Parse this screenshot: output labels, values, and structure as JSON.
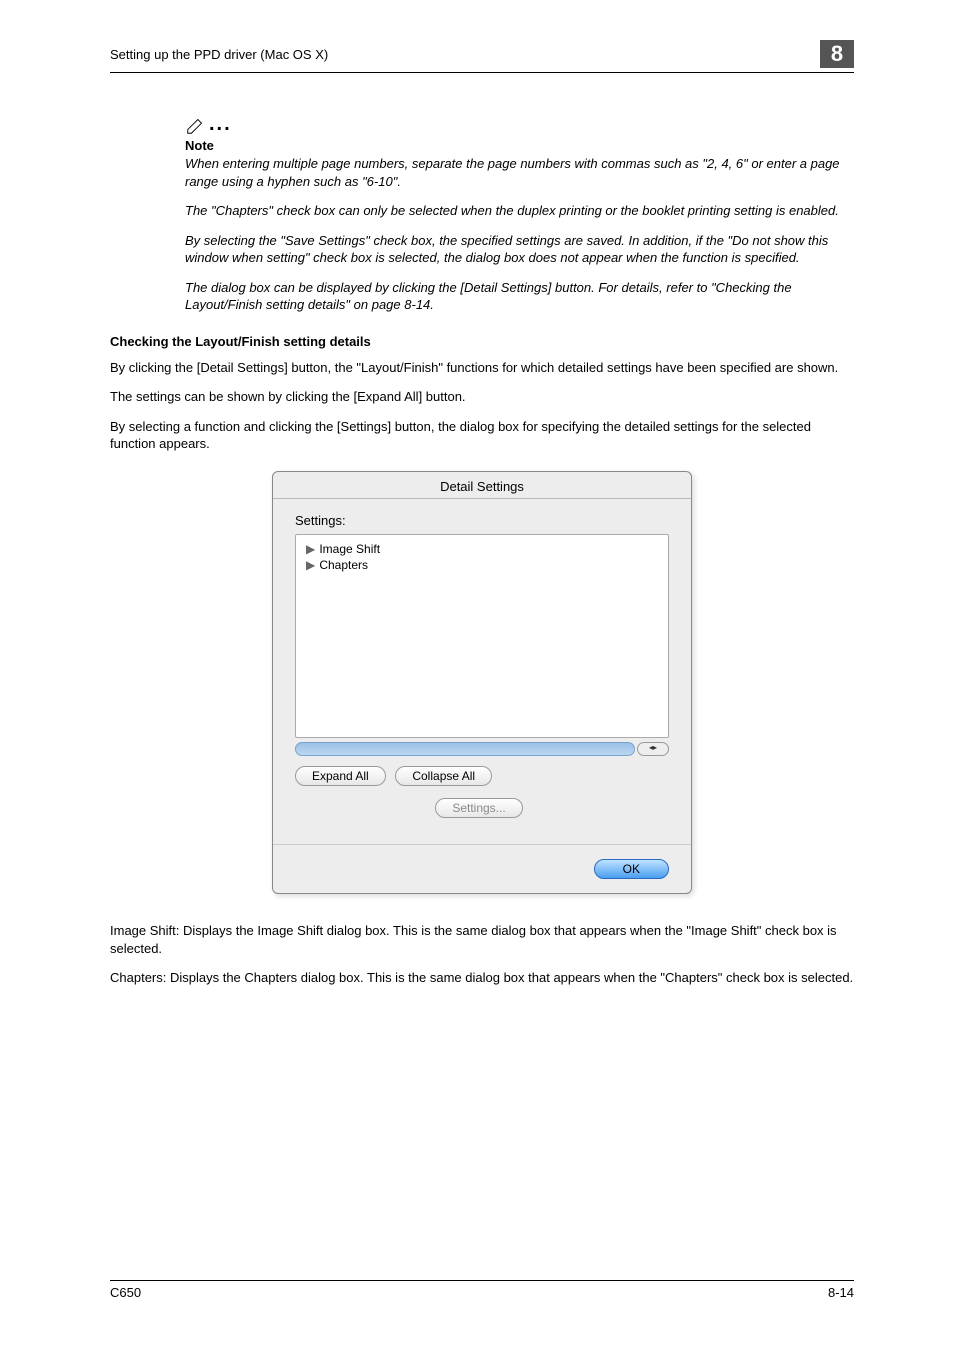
{
  "header": {
    "breadcrumb": "Setting up the PPD driver (Mac OS X)",
    "chapter_number": "8"
  },
  "note_block": {
    "title": "Note",
    "paragraphs": [
      "When entering multiple page numbers, separate the page numbers with commas such as \"2, 4, 6\" or enter a page range using a hyphen such as \"6-10\".",
      "The \"Chapters\" check box can only be selected when the duplex printing or the booklet printing setting is enabled.",
      "By selecting the \"Save Settings\" check box, the specified settings are saved. In addition, if the \"Do not show this window when setting\" check box is selected, the dialog box does not appear when the function is specified.",
      "The dialog box can be displayed by clicking the [Detail Settings] button. For details, refer to \"Checking the Layout/Finish setting details\" on page 8-14."
    ]
  },
  "section": {
    "heading": "Checking the Layout/Finish setting details",
    "body": [
      "By clicking the [Detail Settings] button, the \"Layout/Finish\" functions for which detailed settings have been specified are shown.",
      "The settings can be shown by clicking the [Expand All] button.",
      "By selecting a function and clicking the [Settings] button, the dialog box for specifying the detailed settings for the selected function appears."
    ]
  },
  "dialog": {
    "title": "Detail Settings",
    "settings_label": "Settings:",
    "items": [
      "Image Shift",
      "Chapters"
    ],
    "expand_label": "Expand All",
    "collapse_label": "Collapse All",
    "settings_btn_label": "Settings...",
    "ok_label": "OK"
  },
  "after_dialog": [
    "Image Shift: Displays the Image Shift dialog box. This is the same dialog box that appears when the \"Image Shift\" check box is selected.",
    "Chapters: Displays the Chapters dialog box. This is the same dialog box that appears when the \"Chapters\" check box is selected."
  ],
  "footer": {
    "left": "C650",
    "right": "8-14"
  }
}
